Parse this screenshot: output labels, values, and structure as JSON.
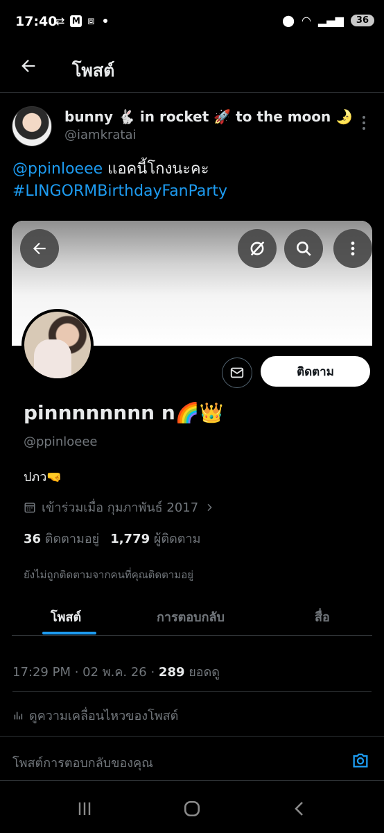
{
  "status_bar": {
    "time": "17:40",
    "mail_badge": "M",
    "battery": "36",
    "wifi_label": "6"
  },
  "header": {
    "title": "โพสต์"
  },
  "post": {
    "author_name": "bunny 🐇 in rocket 🚀 to the moon 🌛",
    "author_handle": "@iamkratai",
    "text_mention": "@ppinloeee",
    "text_body": " แอคนี้โกงนะคะ",
    "text_hashtag": "#LINGORMBirthdayFanParty",
    "timestamp": "17:29 PM · 02 พ.ค. 26 · ",
    "views_count": "289",
    "views_label": " ยอดดู",
    "activity_label": "ดูความเคลื่อนไหวของโพสต์"
  },
  "embedded_profile": {
    "follow_label": "ติดตาม",
    "name": "pinnnnnnnn n🌈👑",
    "handle": "@ppinloeee",
    "bio": "ปภว🤜",
    "joined": "เข้าร่วมเมื่อ กุมภาพันธ์ 2017",
    "following_count": "36",
    "following_label": " ติดตามอยู่",
    "followers_count": "1,779",
    "followers_label": " ผู้ติดตาม",
    "not_followed_note": "ยังไม่ถูกติดตามจากคนที่คุณติดตามอยู่",
    "tabs": [
      "โพสต์",
      "การตอบกลับ",
      "สื่อ"
    ]
  },
  "reply": {
    "placeholder": "โพสต์การตอบกลับของคุณ"
  },
  "colors": {
    "accent": "#1d9bf0",
    "background": "#000000",
    "secondary_text": "#71767b"
  }
}
